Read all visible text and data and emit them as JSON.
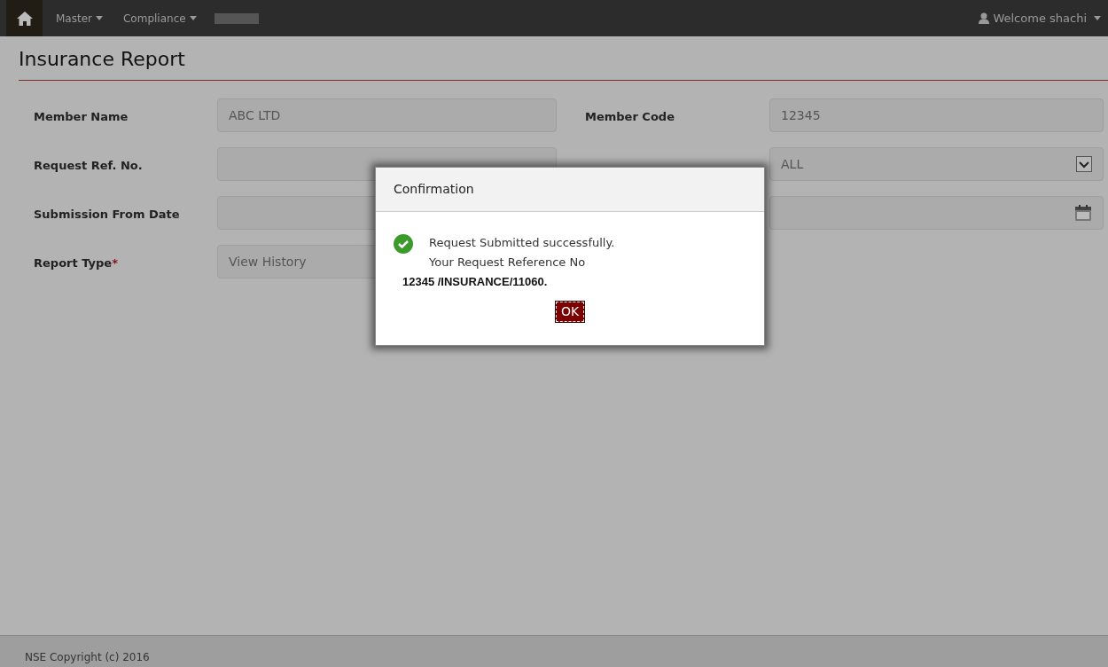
{
  "navbar": {
    "menus": [
      {
        "label": "Master"
      },
      {
        "label": "Compliance"
      }
    ],
    "user": "Welcome shachi"
  },
  "page_title": "Insurance Report",
  "form": {
    "rows": [
      {
        "left": {
          "label": "Member Name",
          "value": "ABC LTD"
        },
        "right": {
          "label": "Member Code",
          "value": "12345"
        }
      },
      {
        "left": {
          "label": "Request Ref. No."
        },
        "right": {
          "value": "ALL",
          "kind": "select"
        }
      },
      {
        "left": {
          "label": "Submission From Date"
        },
        "right": {
          "kind": "date"
        }
      },
      {
        "left": {
          "label": "Report Type",
          "required_mark": "*",
          "value": "View History"
        }
      }
    ]
  },
  "dialog": {
    "title": "Confirmation",
    "lines": [
      "Request Submitted successfully.",
      "Your Request Reference No"
    ],
    "reference": "12345 /INSURANCE/11060.",
    "button": "OK"
  },
  "footer": "NSE Copyright (c) 2016"
}
